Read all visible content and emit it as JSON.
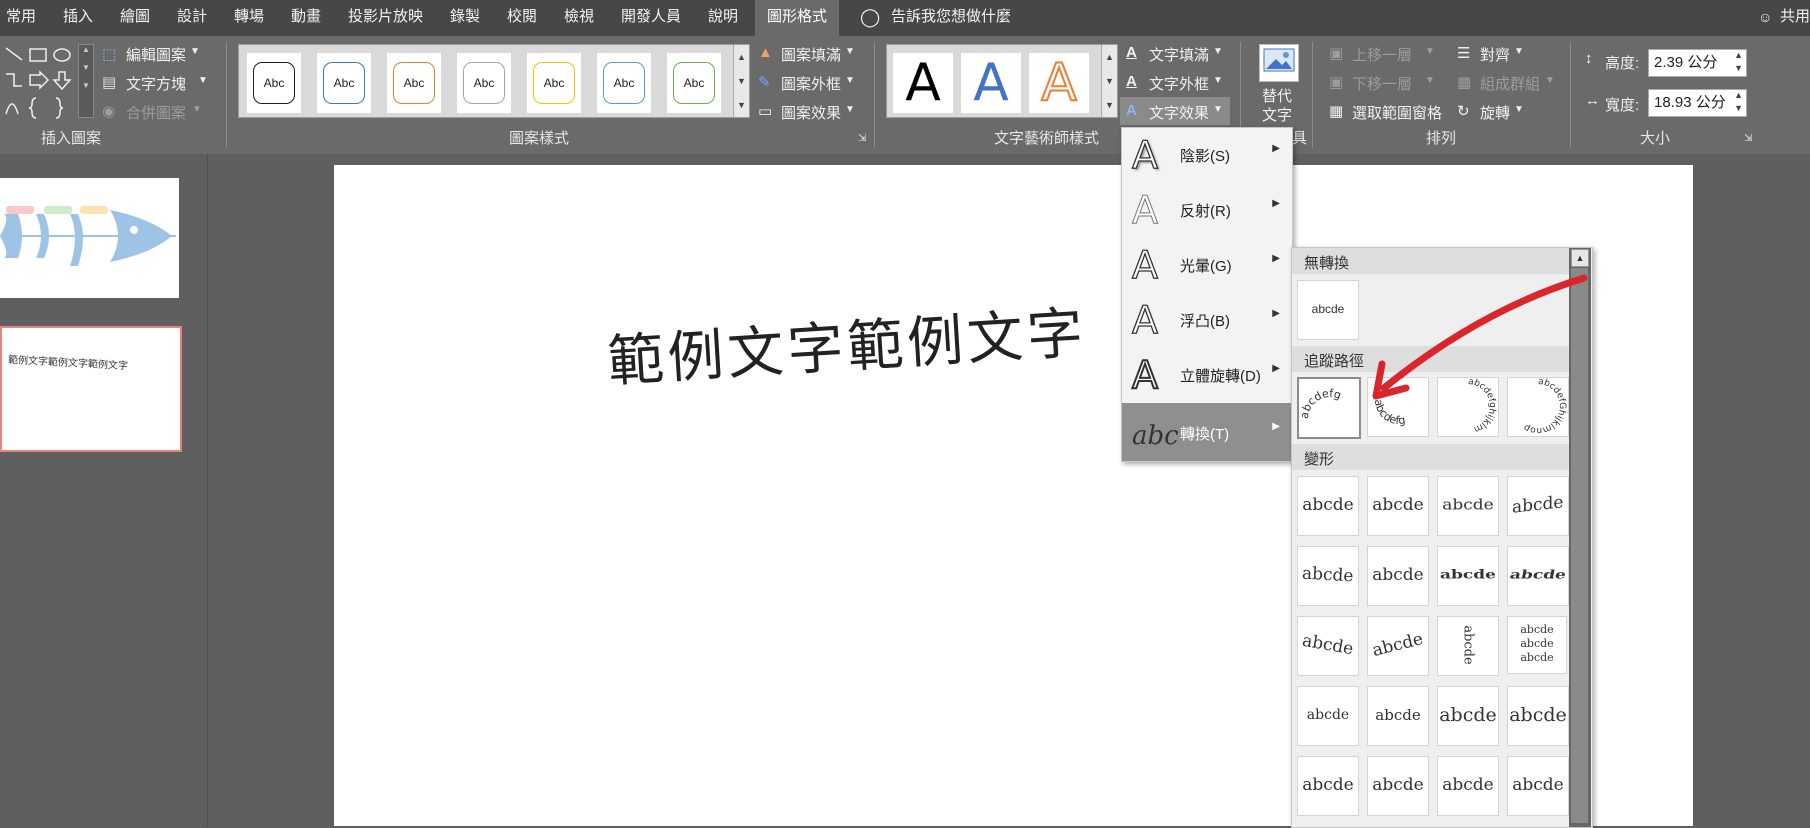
{
  "tabs": [
    "常用",
    "插入",
    "繪圖",
    "設計",
    "轉場",
    "動畫",
    "投影片放映",
    "錄製",
    "校閱",
    "檢視",
    "開發人員",
    "說明",
    "圖形格式"
  ],
  "tell_me": "告訴我您想做什麼",
  "share": "共用",
  "insert_shapes": {
    "edit_shape": "編輯圖案",
    "text_box": "文字方塊",
    "merge_shapes": "合併圖案",
    "label": "插入圖案"
  },
  "shape_styles": {
    "sample": "Abc",
    "colors": [
      "#1f1f1f",
      "#4472c4",
      "#ed7d31",
      "#a5a5a5",
      "#ffc000",
      "#5b9bd5",
      "#70ad47"
    ],
    "fill": "圖案填滿",
    "outline": "圖案外框",
    "effects": "圖案效果",
    "label": "圖案樣式"
  },
  "wordart": {
    "letter": "A",
    "text_fill": "文字填滿",
    "text_outline": "文字外框",
    "text_effects": "文字效果",
    "label": "文字藝術師樣式"
  },
  "alt_text": {
    "line1": "替代",
    "line2": "文字",
    "label_tail": "具"
  },
  "arrange": {
    "bring_forward": "上移一層",
    "send_backward": "下移一層",
    "selection_pane": "選取範圍窗格",
    "align": "對齊",
    "group": "組成群組",
    "rotate": "旋轉",
    "label": "排列"
  },
  "size": {
    "height_label": "高度:",
    "height_value": "2.39 公分",
    "width_label": "寬度:",
    "width_value": "18.93 公分",
    "label": "大小"
  },
  "thumb2_text": "範例文字範例文字範例文字",
  "slide_text": "範例文字範例文字",
  "effects_menu": [
    {
      "label": "陰影(S)"
    },
    {
      "label": "反射(R)"
    },
    {
      "label": "光暈(G)"
    },
    {
      "label": "浮凸(B)"
    },
    {
      "label": "立體旋轉(D)"
    },
    {
      "label": "轉換(T)"
    }
  ],
  "transform": {
    "no_transform": "無轉換",
    "follow_path": "追蹤路徑",
    "warp": "變形",
    "sample": "abcde",
    "path_samples": [
      "abcdefg",
      "abcdefg",
      "abcdefghijklm",
      "abcdefGhijklmnop"
    ]
  }
}
